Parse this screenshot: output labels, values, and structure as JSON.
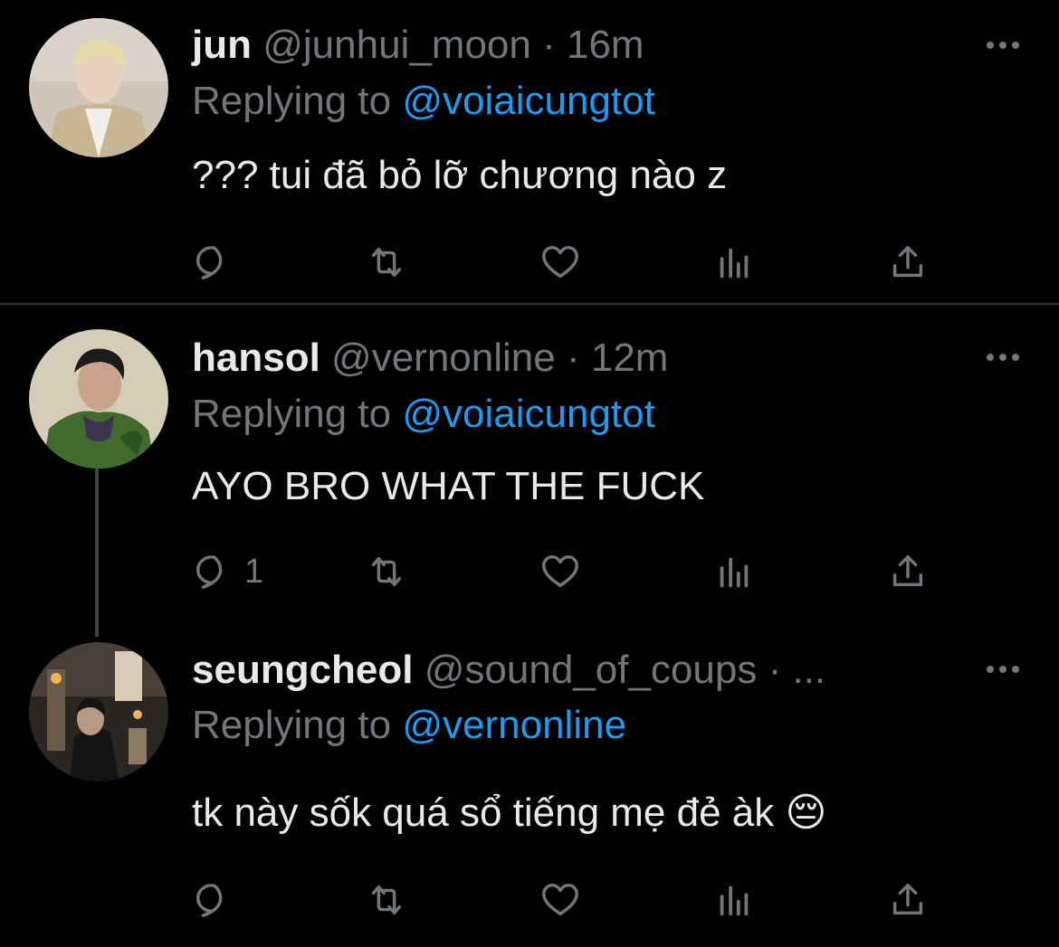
{
  "tweets": [
    {
      "name": "jun",
      "handle": "@junhui_moon",
      "dot": "·",
      "time": "16m",
      "replying_prefix": "Replying to ",
      "replying_to": "@voiaicungtot",
      "text": "??? tui đã bỏ lỡ chương nào z",
      "reply_count": "",
      "avatar_icon": "avatar-jun"
    },
    {
      "name": "hansol",
      "handle": "@vernonline",
      "dot": "·",
      "time": "12m",
      "replying_prefix": "Replying to ",
      "replying_to": "@voiaicungtot",
      "text": "AYO BRO WHAT THE FUCK",
      "reply_count": "1",
      "avatar_icon": "avatar-hansol"
    },
    {
      "name": "seungcheol",
      "handle": "@sound_of_coups",
      "dot": "·",
      "time": "...",
      "replying_prefix": "Replying to ",
      "replying_to": "@vernonline",
      "text": "tk này sốk quá sổ tiếng mẹ đẻ àk",
      "emoji": "😔",
      "reply_count": "",
      "avatar_icon": "avatar-seungcheol"
    }
  ],
  "icons": {
    "reply": "reply-icon",
    "retweet": "retweet-icon",
    "like": "heart-icon",
    "views": "views-icon",
    "share": "share-icon",
    "more": "more-icon"
  },
  "colors": {
    "background": "#000000",
    "text": "#e7e9ea",
    "secondary": "#71767b",
    "accent": "#1d9bf0",
    "divider": "#2f3336"
  }
}
